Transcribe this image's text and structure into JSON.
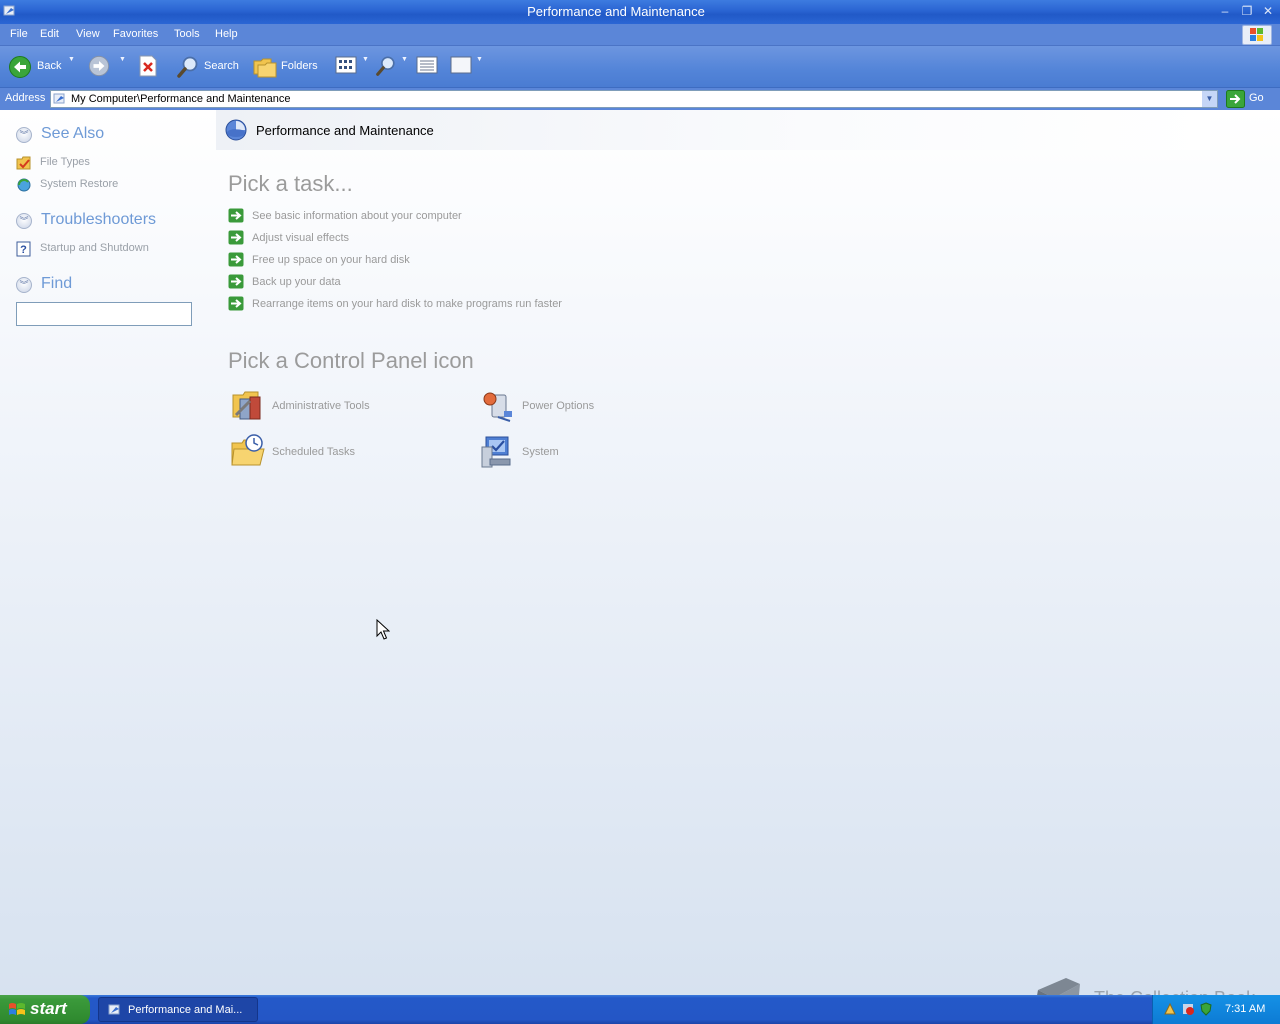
{
  "window": {
    "title": "Performance and Maintenance",
    "controls": {
      "minimize": "–",
      "restore": "❐",
      "close": "✕"
    }
  },
  "menu": [
    "File",
    "Edit",
    "View",
    "Favorites",
    "Tools",
    "Help"
  ],
  "toolbar": {
    "back_label": "Back",
    "search_label": "Search",
    "folders_label": "Folders"
  },
  "address": {
    "label": "Address",
    "value": "My Computer\\Performance and Maintenance",
    "go_label": "Go"
  },
  "sidebar": {
    "see_also": {
      "title": "See Also",
      "items": [
        {
          "label": "File Types",
          "icon": "file-types-icon"
        },
        {
          "label": "System Restore",
          "icon": "system-restore-icon"
        }
      ]
    },
    "troubleshooters": {
      "title": "Troubleshooters",
      "items": [
        {
          "label": "Startup and Shutdown",
          "icon": "help-icon"
        }
      ]
    },
    "find": {
      "title": "Find",
      "value": ""
    }
  },
  "main": {
    "header_title": "Performance and Maintenance",
    "tasks_title": "Pick a task...",
    "tasks": [
      "See basic information about your computer",
      "Adjust visual effects",
      "Free up space on your hard disk",
      "Back up your data",
      "Rearrange items on your hard disk to make programs run faster"
    ],
    "icons_title": "Pick a Control Panel icon",
    "icons": [
      {
        "label": "Administrative Tools",
        "icon": "administrative-tools-icon"
      },
      {
        "label": "Power Options",
        "icon": "power-options-icon"
      },
      {
        "label": "Scheduled Tasks",
        "icon": "scheduled-tasks-icon"
      },
      {
        "label": "System",
        "icon": "system-icon"
      }
    ]
  },
  "watermark": {
    "text": "The Collection Book"
  },
  "taskbar": {
    "start_label": "start",
    "task_label": "Performance and Mai...",
    "clock": "7:31 AM"
  },
  "colors": {
    "titlebar": "#2a64d2",
    "section_heading": "#6e9ad6",
    "task_arrow": "#3a9a3a",
    "start_button": "#3b9a3b"
  }
}
